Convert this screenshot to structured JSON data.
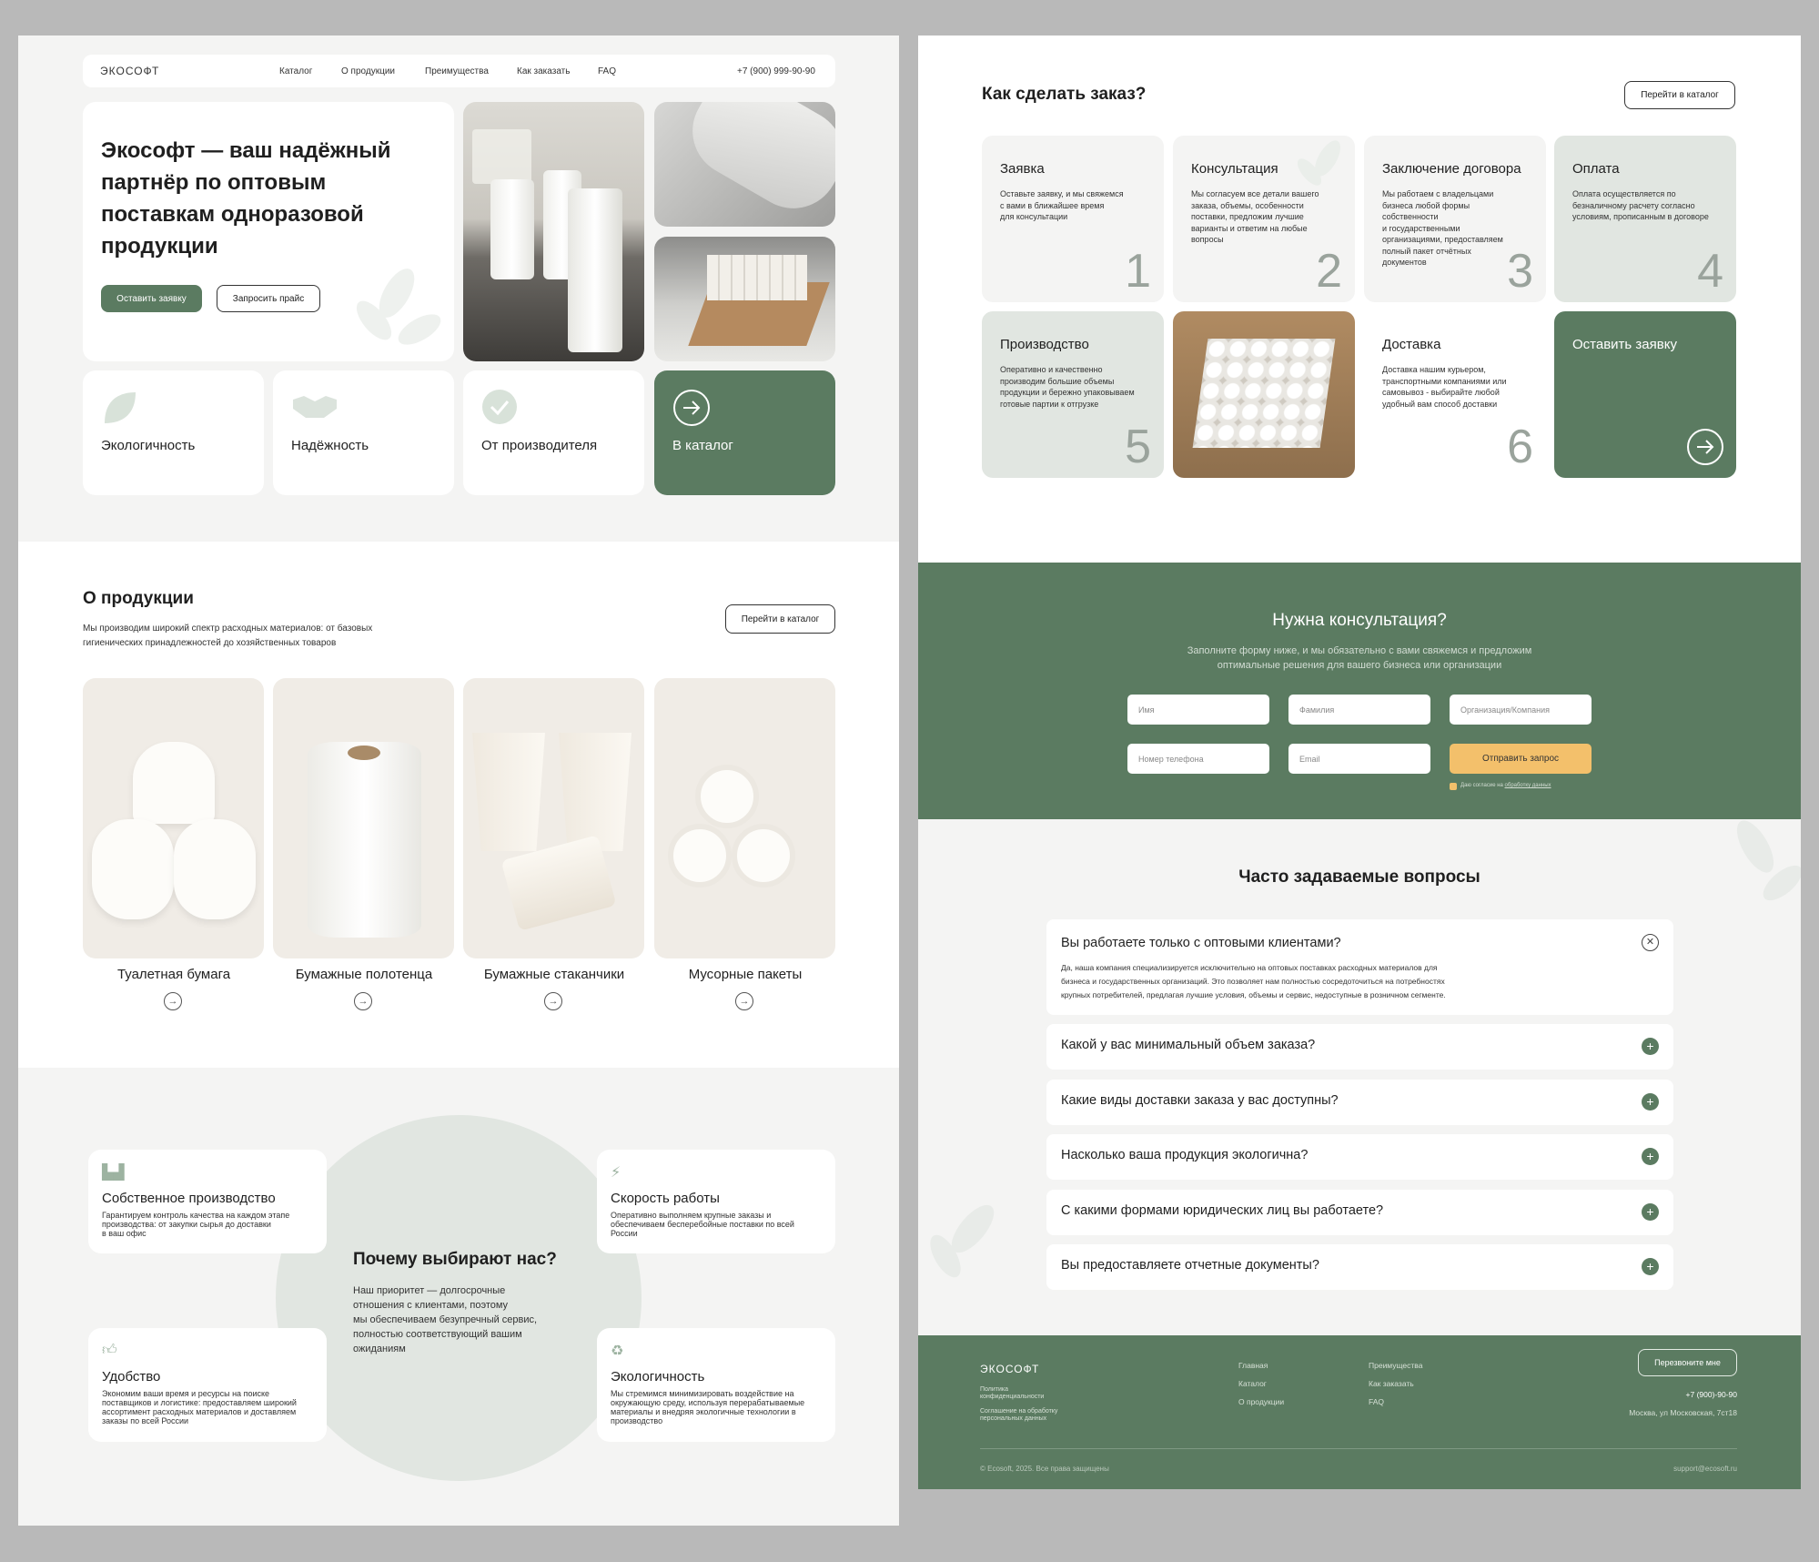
{
  "brand": {
    "logo": "ЭКОСОФТ"
  },
  "nav": {
    "items": [
      "Каталог",
      "О продукции",
      "Преимущества",
      "Как заказать",
      "FAQ"
    ],
    "phone": "+7 (900) 999-90-90"
  },
  "hero": {
    "title_lines": [
      "Экософт — ваш надёжный",
      "партнёр по оптовым",
      "поставкам одноразовой",
      "продукции"
    ],
    "btn_request": "Оставить заявку",
    "btn_price": "Запросить прайс"
  },
  "features": [
    {
      "label": "Экологичность",
      "icon": "leaf-icon"
    },
    {
      "label": "Надёжность",
      "icon": "handshake-icon"
    },
    {
      "label": "От производителя",
      "icon": "check-circle-icon"
    },
    {
      "label": "В каталог",
      "icon": "arrow-right-circle-icon"
    }
  ],
  "about": {
    "title": "О продукции",
    "subtitle_lines": [
      "Мы производим широкий спектр расходных материалов: от базовых",
      "гигиенических принадлежностей до хозяйственных товаров"
    ],
    "btn_catalog": "Перейти в каталог",
    "products": [
      {
        "name": "Туалетная бумага"
      },
      {
        "name": "Бумажные полотенца"
      },
      {
        "name": "Бумажные стаканчики"
      },
      {
        "name": "Мусорные пакеты"
      }
    ]
  },
  "why": {
    "title": "Почему выбирают нас?",
    "text_lines": [
      "Наш приоритет — долгосрочные",
      "отношения с клиентами, поэтому",
      "мы обеспечиваем безупречный сервис,",
      "полностью соответствующий вашим",
      "ожиданиям"
    ],
    "cards": [
      {
        "title": "Собственное производство",
        "icon": "factory-icon",
        "text_lines": [
          "Гарантируем контроль качества на каждом этапе",
          "производства: от закупки сырья до доставки",
          "в ваш офис"
        ]
      },
      {
        "title": "Скорость работы",
        "icon": "lightning-icon",
        "text_lines": [
          "Оперативно выполняем крупные заказы и",
          "обеспечиваем бесперебойные поставки по всей",
          "России"
        ]
      },
      {
        "title": "Удобство",
        "icon": "thumbs-up-icon",
        "text_lines": [
          "Экономим ваши время и ресурсы на поиске",
          "поставщиков и логистике: предоставляем широкий",
          "ассортимент расходных материалов и доставляем",
          "заказы по всей России"
        ]
      },
      {
        "title": "Экологичность",
        "icon": "recycle-icon",
        "text_lines": [
          "Мы стремимся минимизировать воздействие на",
          "окружающую среду, используя перерабатываемые",
          "материалы и внедряя экологичные технологии в",
          "производство"
        ]
      }
    ]
  },
  "order": {
    "title": "Как сделать заказ?",
    "btn_catalog": "Перейти в каталог",
    "steps": [
      {
        "title": "Заявка",
        "num": "1",
        "text_lines": [
          "Оставьте заявку, и мы свяжемся",
          "с вами в ближайшее время",
          "для консультации"
        ]
      },
      {
        "title": "Консультация",
        "num": "2",
        "text_lines": [
          "Мы согласуем все детали вашего",
          "заказа, объемы, особенности",
          "поставки, предложим лучшие",
          "варианты и ответим на любые",
          "вопросы"
        ]
      },
      {
        "title": "Заключение договора",
        "num": "3",
        "text_lines": [
          "Мы работаем с владельцами",
          "бизнеса любой формы",
          "собственности",
          "и государственными",
          "организациями, предоставляем",
          "полный пакет отчётных",
          "документов"
        ]
      },
      {
        "title": "Оплата",
        "num": "4",
        "text_lines": [
          "Оплата осуществляется по",
          "безналичному расчету согласно",
          "условиям, прописанным в договоре"
        ]
      },
      {
        "title": "Производство",
        "num": "5",
        "text_lines": [
          "Оперативно и качественно",
          "производим большие объемы",
          "продукции и бережно упаковываем",
          "готовые партии к отгрузке"
        ]
      },
      {
        "title": "Доставка",
        "num": "6",
        "text_lines": [
          "Доставка нашим курьером,",
          "транспортными компаниями или",
          "самовывоз - выбирайте любой",
          "удобный вам способ доставки"
        ]
      }
    ],
    "cta": "Оставить заявку"
  },
  "consult": {
    "title": "Нужна консультация?",
    "subtitle_lines": [
      "Заполните форму ниже, и мы обязательно с вами свяжемся и предложим",
      "оптимальные решения для вашего бизнеса или организации"
    ],
    "placeholders": {
      "name": "Имя",
      "surname": "Фамилия",
      "org": "Организация/Компания",
      "phone": "Номер телефона",
      "email": "Email"
    },
    "submit": "Отправить запрос",
    "consent_prefix": "Даю согласие на",
    "consent_link": "обработку данных"
  },
  "faq": {
    "title": "Часто задаваемые вопросы",
    "open": {
      "q": "Вы работаете только с оптовыми клиентами?",
      "a_lines": [
        "Да, наша компания специализируется исключительно на оптовых поставках расходных материалов для",
        "бизнеса и государственных организаций. Это позволяет нам полностью сосредоточиться на потребностях",
        "крупных потребителей, предлагая лучшие условия, объемы и сервис, недоступные в розничном сегменте."
      ]
    },
    "items": [
      "Какой у вас минимальный объем заказа?",
      "Какие виды доставки заказа у вас доступны?",
      "Насколько ваша продукция экологична?",
      "С какими формами юридических лиц вы работаете?",
      "Вы предоставляете отчетные документы?"
    ]
  },
  "footer": {
    "logo": "ЭКОСОФТ",
    "policy": [
      "Политика",
      "конфиденциальности"
    ],
    "agreement": [
      "Соглашение на обработку",
      "персональных данных"
    ],
    "col1": [
      "Главная",
      "Каталог",
      "О продукции"
    ],
    "col2": [
      "Преимущества",
      "Как заказать",
      "FAQ"
    ],
    "callback": "Перезвоните мне",
    "phone": "+7 (900)-90-90",
    "address": "Москва, ул Московская, 7ст18",
    "copyright": "©  Ecosoft, 2025. Все права защищены",
    "email": "support@ecosoft.ru"
  },
  "colors": {
    "brand_green": "#5b7b61",
    "light_green": "#e1e6e1",
    "accent_yellow": "#f3c06b"
  }
}
